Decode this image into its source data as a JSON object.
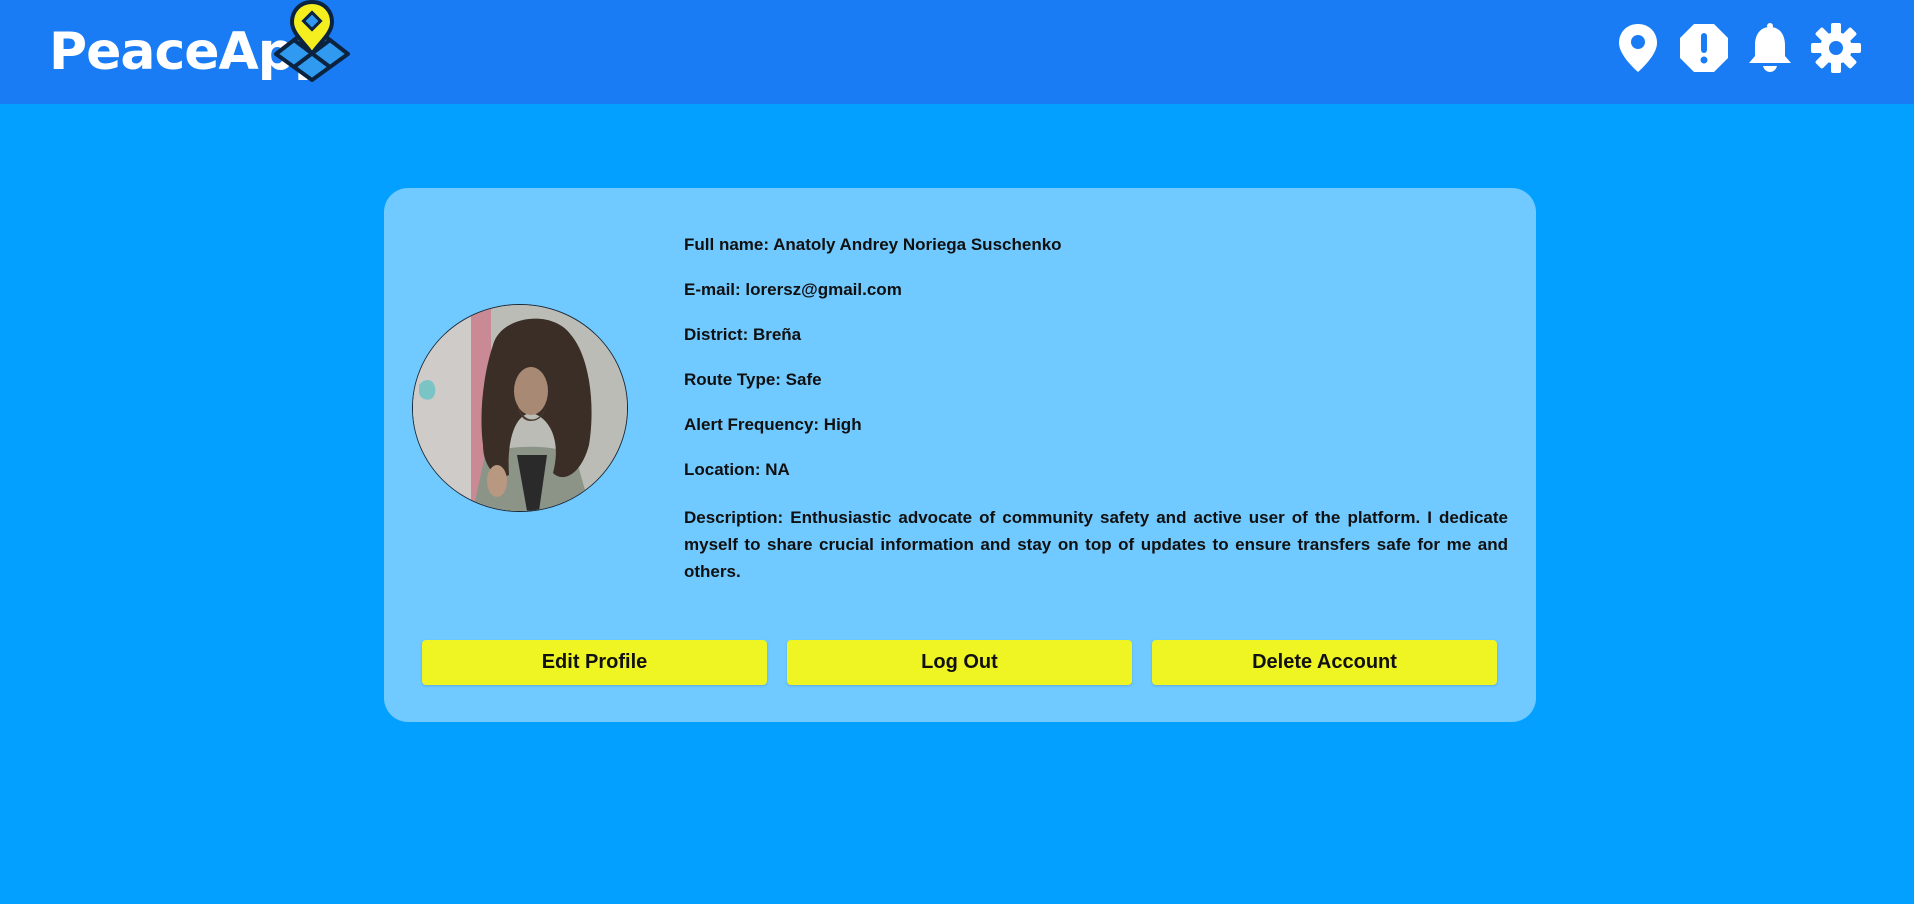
{
  "header": {
    "app_name": "PeaceApp",
    "logo_icon": "map-pin-logo",
    "nav": [
      {
        "icon": "location-pin-icon"
      },
      {
        "icon": "alert-icon"
      },
      {
        "icon": "bell-icon"
      },
      {
        "icon": "gear-icon"
      }
    ]
  },
  "profile": {
    "avatar_icon": "profile-photo",
    "full_name": "Full name: Anatoly Andrey Noriega Suschenko",
    "email": "E-mail: lorersz@gmail.com",
    "district": "District: Breña",
    "route_type": "Route Type: Safe",
    "alert_frequency": "Alert Frequency: High",
    "location": "Location: NA",
    "description": "Description: Enthusiastic advocate of community safety and active user of the platform. I dedicate myself to share crucial information and stay on top of updates to ensure transfers safe for me and others."
  },
  "actions": {
    "edit_label": "Edit Profile",
    "logout_label": "Log Out",
    "delete_label": "Delete Account"
  },
  "colors": {
    "page_bg": "#03a0ff",
    "header_bg": "#1a7cf5",
    "card_bg": "#70c9ff",
    "button_bg": "#eff522",
    "logo_yellow": "#f5ef1f"
  }
}
